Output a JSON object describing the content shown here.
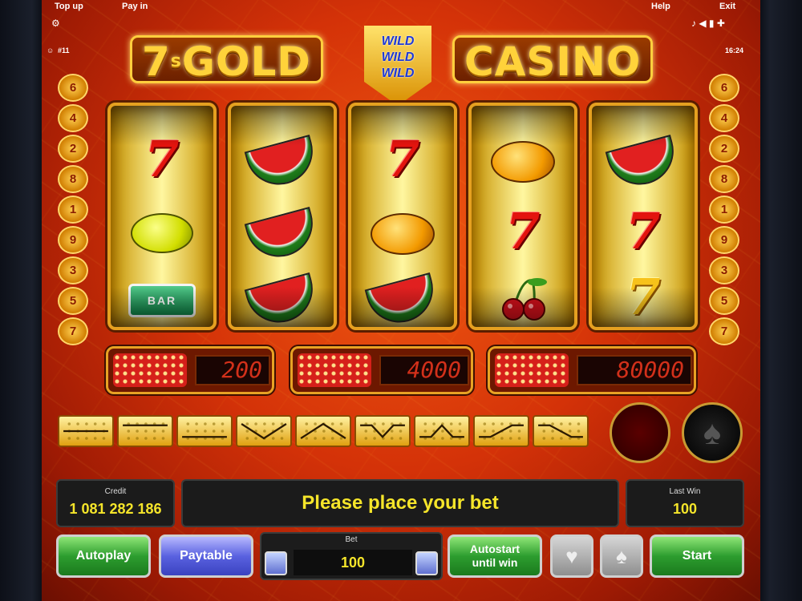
{
  "topbar": {
    "top_up": "Top up",
    "pay_in": "Pay in",
    "help": "Help",
    "exit": "Exit",
    "player_count": "#11",
    "clock": "16:24"
  },
  "logo": {
    "left_main": "7",
    "left_sup": "s",
    "left_rest": "GOLD",
    "right": "CASINO",
    "wild": [
      "WILD",
      "WILD",
      "WILD"
    ]
  },
  "lines_left": [
    "6",
    "4",
    "2",
    "8",
    "1",
    "9",
    "3",
    "5",
    "7"
  ],
  "lines_right": [
    "6",
    "4",
    "2",
    "8",
    "1",
    "9",
    "3",
    "5",
    "7"
  ],
  "reels": [
    [
      "seven",
      "lemon",
      "bar"
    ],
    [
      "melon",
      "melon",
      "melon"
    ],
    [
      "seven",
      "orange",
      "melon"
    ],
    [
      "orange",
      "seven",
      "cherry"
    ],
    [
      "melon",
      "seven",
      "seven-gold"
    ]
  ],
  "bar_label": "BAR",
  "paytable": [
    {
      "value": "200"
    },
    {
      "value": "4000"
    },
    {
      "value": "80000"
    }
  ],
  "panel": {
    "credit_label": "Credit",
    "credit_value": "1 081 282 186",
    "message": "Please place your bet",
    "last_win_label": "Last Win",
    "last_win_value": "100"
  },
  "controls": {
    "autoplay": "Autoplay",
    "paytable": "Paytable",
    "bet_label": "Bet",
    "bet_value": "100",
    "autostart_line1": "Autostart",
    "autostart_line2": "until win",
    "start": "Start"
  },
  "colors": {
    "accent": "#f5e52a",
    "button_green": "#2d9d2f",
    "button_blue": "#5a62e0"
  }
}
